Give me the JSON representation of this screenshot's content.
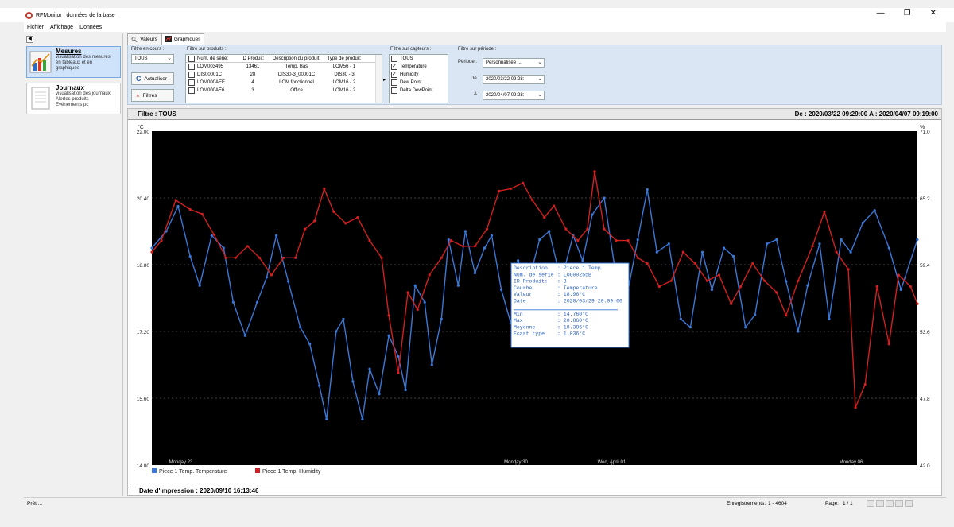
{
  "window": {
    "title": "RFMonitor : données de la base",
    "minimize": "—",
    "restore": "❐",
    "close": "✕"
  },
  "menu": [
    "Fichier",
    "Affichage",
    "Données"
  ],
  "nav": {
    "collapse": "◀",
    "mesures": {
      "title": "Mesures",
      "lines": [
        "visualisation des mesures",
        "en tableaux et en",
        "graphiques"
      ]
    },
    "journaux": {
      "title": "Journaux",
      "lines": [
        "visualisation des journaux",
        "Alertes produits",
        "Evénements pc"
      ]
    }
  },
  "tabs": [
    {
      "label": "Valeurs",
      "icon": "magnifier-icon"
    },
    {
      "label": "Graphiques",
      "icon": "chart-icon"
    }
  ],
  "filters": {
    "current": {
      "label": "Filtre en cours :",
      "value": "TOUS"
    },
    "refresh_button": "Actualiser",
    "filters_button": "Filtres",
    "products": {
      "label": "Filtre sur produits :",
      "headers": [
        "Num. de série:",
        "ID Produit:",
        "Description du produit:",
        "Type de produit:"
      ],
      "rows": [
        [
          "LOM003495",
          "13461",
          "Temp. Bas",
          "LOM56 - 1"
        ],
        [
          "DIS00001C",
          "28",
          "DIS30-3_00001C",
          "DIS30 - 3"
        ],
        [
          "LOM000AEE",
          "4",
          "LOM fonctionnel",
          "LOM16 - 2"
        ],
        [
          "LOM000AE6",
          "3",
          "Office",
          "LOM16 - 2"
        ]
      ]
    },
    "sensors": {
      "label": "Filtre sur capteurs :",
      "items": [
        {
          "label": "TOUS",
          "checked": false
        },
        {
          "label": "Temperature",
          "checked": true
        },
        {
          "label": "Humidity",
          "checked": true
        },
        {
          "label": "Dew Point",
          "checked": false
        },
        {
          "label": "Delta DewPoint",
          "checked": false
        }
      ]
    },
    "period": {
      "label": "Filtre sur période :",
      "period_label": "Période :",
      "period_value": "Personnalisée ...",
      "from_label": "De :",
      "from_value": "2020/03/22 09:28:",
      "to_label": "A :",
      "to_value": "2020/04/07 09:28:"
    }
  },
  "chart_header": {
    "filter": "Filtre : TOUS",
    "range": "De : 2020/03/22 09:29:00    A : 2020/04/07 09:19:00"
  },
  "chart_data": {
    "type": "line",
    "y_left_unit": "°C",
    "y_right_unit": "%",
    "y_left_ticks": [
      "22.00",
      "20.40",
      "18.80",
      "17.20",
      "15.60",
      "14.00"
    ],
    "y_right_ticks": [
      "71.0",
      "65.2",
      "59.4",
      "53.6",
      "47.8",
      "42.0"
    ],
    "y_left_range": [
      14.0,
      22.0
    ],
    "y_right_range": [
      42.0,
      71.0
    ],
    "x_labels": [
      "Monday 23",
      "Monday 30",
      "Wed, April 01",
      "Monday 06"
    ],
    "x_label_positions_days": [
      0.606,
      7.606,
      9.606,
      14.606
    ],
    "x_range_days": [
      0,
      15.993
    ],
    "grid": true,
    "legend_position": "bottom-left",
    "colors": {
      "temperature": "#3a78d8",
      "humidity": "#d21f1f",
      "background": "#000000"
    },
    "series": [
      {
        "name": "Piece 1 Temp. Temperature",
        "axis": "left",
        "points": [
          [
            0,
            19.2
          ],
          [
            0.3,
            19.6
          ],
          [
            0.55,
            20.2
          ],
          [
            0.8,
            19.0
          ],
          [
            1.0,
            18.3
          ],
          [
            1.25,
            19.5
          ],
          [
            1.5,
            19.2
          ],
          [
            1.7,
            17.9
          ],
          [
            1.95,
            17.1
          ],
          [
            2.2,
            17.9
          ],
          [
            2.4,
            18.5
          ],
          [
            2.6,
            19.5
          ],
          [
            2.85,
            18.4
          ],
          [
            3.1,
            17.3
          ],
          [
            3.3,
            16.9
          ],
          [
            3.5,
            15.9
          ],
          [
            3.65,
            15.1
          ],
          [
            3.85,
            17.2
          ],
          [
            4.0,
            17.5
          ],
          [
            4.2,
            16.0
          ],
          [
            4.4,
            15.1
          ],
          [
            4.55,
            16.3
          ],
          [
            4.75,
            15.7
          ],
          [
            4.95,
            17.1
          ],
          [
            5.15,
            16.6
          ],
          [
            5.3,
            15.8
          ],
          [
            5.5,
            18.3
          ],
          [
            5.7,
            17.9
          ],
          [
            5.85,
            16.4
          ],
          [
            6.05,
            17.5
          ],
          [
            6.2,
            19.4
          ],
          [
            6.4,
            18.3
          ],
          [
            6.55,
            19.6
          ],
          [
            6.75,
            18.6
          ],
          [
            6.95,
            19.2
          ],
          [
            7.1,
            19.5
          ],
          [
            7.3,
            18.2
          ],
          [
            7.5,
            17.4
          ],
          [
            7.65,
            18.9
          ],
          [
            7.85,
            18.3
          ],
          [
            8.1,
            19.4
          ],
          [
            8.3,
            19.6
          ],
          [
            8.55,
            18.4
          ],
          [
            8.8,
            19.5
          ],
          [
            9.0,
            18.9
          ],
          [
            9.2,
            20.0
          ],
          [
            9.45,
            20.4
          ],
          [
            9.7,
            18.5
          ],
          [
            9.95,
            18.2
          ],
          [
            10.15,
            19.4
          ],
          [
            10.35,
            20.6
          ],
          [
            10.55,
            19.1
          ],
          [
            10.8,
            19.3
          ],
          [
            11.05,
            17.5
          ],
          [
            11.25,
            17.3
          ],
          [
            11.5,
            19.1
          ],
          [
            11.7,
            18.2
          ],
          [
            11.95,
            19.2
          ],
          [
            12.15,
            19.0
          ],
          [
            12.4,
            17.3
          ],
          [
            12.6,
            17.6
          ],
          [
            12.85,
            19.3
          ],
          [
            13.05,
            19.4
          ],
          [
            13.25,
            18.4
          ],
          [
            13.5,
            17.2
          ],
          [
            13.7,
            18.3
          ],
          [
            13.95,
            19.3
          ],
          [
            14.15,
            17.5
          ],
          [
            14.4,
            19.4
          ],
          [
            14.6,
            19.1
          ],
          [
            14.85,
            19.8
          ],
          [
            15.1,
            20.1
          ],
          [
            15.4,
            19.2
          ],
          [
            15.65,
            18.2
          ],
          [
            15.993,
            19.4
          ]
        ]
      },
      {
        "name": "Piece 1 Temp. Humidity",
        "axis": "right",
        "points": [
          [
            0,
            60.5
          ],
          [
            0.2,
            61.5
          ],
          [
            0.5,
            65.0
          ],
          [
            0.8,
            64.2
          ],
          [
            1.05,
            63.8
          ],
          [
            1.3,
            62.0
          ],
          [
            1.55,
            60.0
          ],
          [
            1.75,
            60.0
          ],
          [
            2.0,
            61.0
          ],
          [
            2.25,
            60.0
          ],
          [
            2.5,
            58.5
          ],
          [
            2.75,
            60.0
          ],
          [
            3.0,
            60.0
          ],
          [
            3.2,
            62.5
          ],
          [
            3.4,
            63.2
          ],
          [
            3.6,
            66.0
          ],
          [
            3.8,
            64.0
          ],
          [
            4.05,
            63.0
          ],
          [
            4.3,
            63.5
          ],
          [
            4.55,
            61.5
          ],
          [
            4.8,
            60.0
          ],
          [
            4.95,
            55.0
          ],
          [
            5.15,
            50.0
          ],
          [
            5.35,
            57.0
          ],
          [
            5.55,
            55.5
          ],
          [
            5.8,
            58.5
          ],
          [
            6.05,
            60.0
          ],
          [
            6.25,
            61.5
          ],
          [
            6.5,
            61.0
          ],
          [
            6.75,
            61.0
          ],
          [
            7.0,
            62.5
          ],
          [
            7.25,
            65.8
          ],
          [
            7.5,
            66.0
          ],
          [
            7.75,
            66.5
          ],
          [
            7.95,
            65.0
          ],
          [
            8.2,
            63.5
          ],
          [
            8.4,
            64.5
          ],
          [
            8.65,
            62.5
          ],
          [
            8.9,
            61.5
          ],
          [
            9.1,
            62.5
          ],
          [
            9.25,
            67.5
          ],
          [
            9.45,
            62.5
          ],
          [
            9.7,
            61.5
          ],
          [
            9.95,
            61.5
          ],
          [
            10.15,
            60.0
          ],
          [
            10.35,
            59.5
          ],
          [
            10.6,
            57.5
          ],
          [
            10.85,
            58.0
          ],
          [
            11.1,
            60.5
          ],
          [
            11.35,
            59.5
          ],
          [
            11.6,
            58.0
          ],
          [
            11.85,
            58.5
          ],
          [
            12.1,
            56.0
          ],
          [
            12.3,
            57.5
          ],
          [
            12.55,
            59.5
          ],
          [
            12.8,
            58.0
          ],
          [
            13.05,
            57.0
          ],
          [
            13.25,
            55.0
          ],
          [
            13.5,
            58.0
          ],
          [
            13.8,
            61.0
          ],
          [
            14.05,
            64.0
          ],
          [
            14.3,
            60.5
          ],
          [
            14.55,
            59.0
          ],
          [
            14.7,
            47.0
          ],
          [
            14.9,
            49.0
          ],
          [
            15.15,
            57.5
          ],
          [
            15.4,
            52.5
          ],
          [
            15.6,
            58.5
          ],
          [
            15.85,
            57.5
          ],
          [
            15.993,
            56.0
          ]
        ]
      }
    ],
    "tooltip": {
      "lines": [
        [
          "Description",
          ": Piece 1 Temp."
        ],
        [
          "Num. de série",
          ": LOG00255B"
        ],
        [
          "ID Produit:",
          ": 3"
        ],
        [
          "Courbe",
          ": Temperature"
        ],
        [
          "Valeur",
          ": 18.96°C"
        ],
        [
          "Date",
          ": 2020/03/29 20:09:00"
        ],
        [
          "",
          ""
        ],
        [
          "Min",
          ": 14.760°C"
        ],
        [
          "Max",
          ": 20.860°C"
        ],
        [
          "Moyenne",
          ": 18.386°C"
        ],
        [
          "Ecart type",
          ": 1.036°C"
        ]
      ]
    }
  },
  "print_date": "Date d'impression : 2020/09/10 16:13:46",
  "status": {
    "ready": "Prêt ...",
    "records_label": "Enregistrements:",
    "records_value": "1 - 4604",
    "page_label": "Page:",
    "page_value": "1 / 1"
  }
}
